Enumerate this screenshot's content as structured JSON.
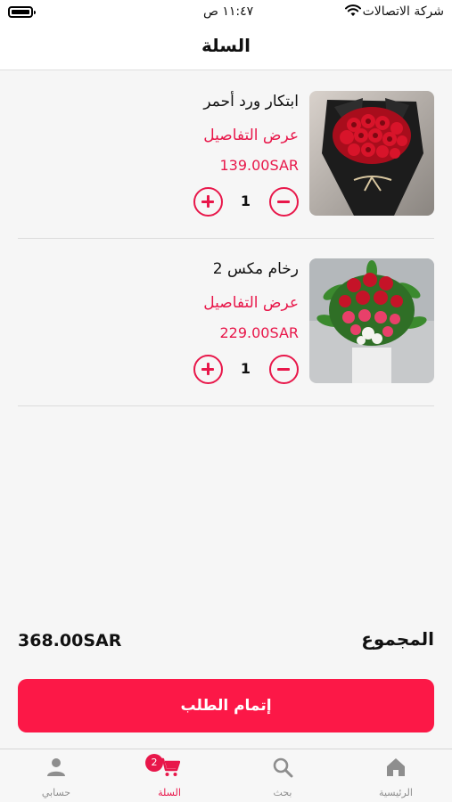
{
  "status_bar": {
    "carrier": "شركة الاتصالات",
    "time": "١١:٤٧ ص"
  },
  "nav": {
    "title": "السلة"
  },
  "cart": {
    "items": [
      {
        "name": "ابتكار ورد أحمر",
        "details_label": "عرض التفاصيل",
        "price": "139.00SAR",
        "quantity": "1",
        "image": "red-roses-bouquet"
      },
      {
        "name": "رخام مكس 2",
        "details_label": "عرض التفاصيل",
        "price": "229.00SAR",
        "quantity": "1",
        "image": "mixed-flowers-arrangement"
      }
    ]
  },
  "summary": {
    "total_label": "المجموع",
    "total_value": "368.00SAR"
  },
  "checkout_label": "إتمام الطلب",
  "tabs": [
    {
      "label": "الرئيسية",
      "icon": "home-icon"
    },
    {
      "label": "بحث",
      "icon": "search-icon"
    },
    {
      "label": "السلة",
      "icon": "cart-icon",
      "badge": "2",
      "active": true
    },
    {
      "label": "حسابي",
      "icon": "person-icon"
    }
  ],
  "colors": {
    "accent": "#e8174a",
    "checkout": "#fc1847",
    "tab_inactive": "#8e8e8e"
  }
}
